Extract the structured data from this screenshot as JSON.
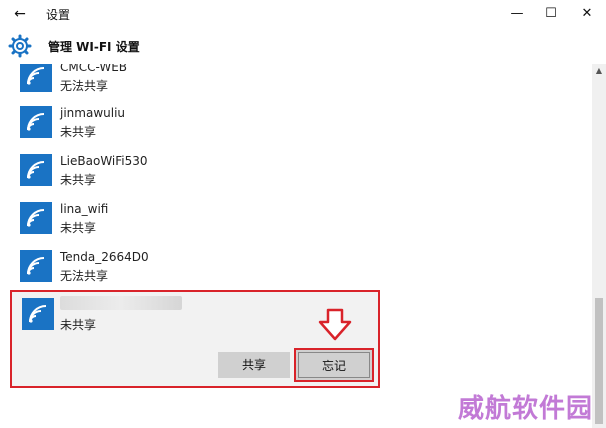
{
  "window": {
    "title": "设置",
    "back_glyph": "←",
    "min_glyph": "—",
    "max_glyph": "☐",
    "close_glyph": "✕"
  },
  "header": {
    "title": "管理 WI-FI 设置",
    "icon": "gear-icon"
  },
  "networks": [
    {
      "name": "CMCC-WEB",
      "status": "无法共享",
      "icon": "wifi-icon"
    },
    {
      "name": "jinmawuliu",
      "status": "未共享",
      "icon": "wifi-icon"
    },
    {
      "name": "LieBaoWiFi530",
      "status": "未共享",
      "icon": "wifi-icon"
    },
    {
      "name": "lina_wifi",
      "status": "未共享",
      "icon": "wifi-icon"
    },
    {
      "name": "Tenda_2664D0",
      "status": "无法共享",
      "icon": "wifi-icon"
    }
  ],
  "selected": {
    "status": "未共享",
    "share_label": "共享",
    "forget_label": "忘记"
  },
  "watermark": "威航软件园",
  "colors": {
    "accent": "#1a73c4",
    "highlight": "#d9232a"
  }
}
